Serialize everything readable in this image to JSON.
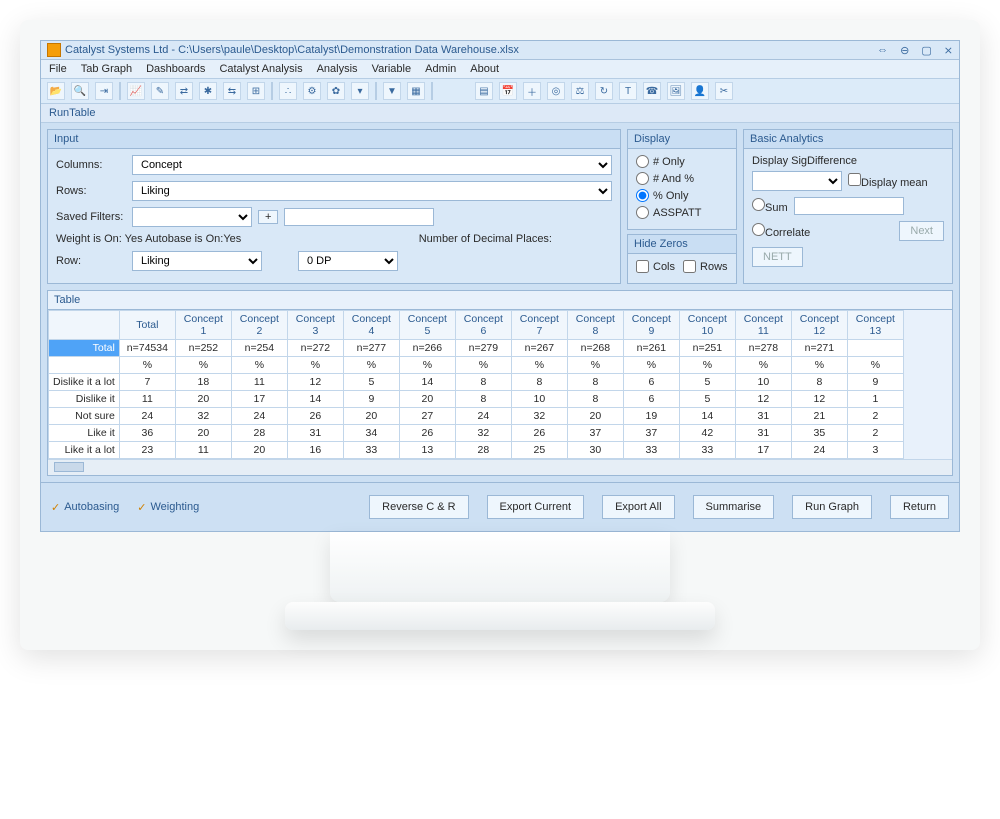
{
  "window": {
    "title": "Catalyst Systems Ltd - C:\\Users\\paule\\Desktop\\Catalyst\\Demonstration Data Warehouse.xlsx",
    "btn_link": "⇔",
    "btn_min": "⊖",
    "btn_max": "▢",
    "btn_close": "⨯"
  },
  "menu": [
    "File",
    "Tab Graph",
    "Dashboards",
    "Catalyst Analysis",
    "Analysis",
    "Variable",
    "Admin",
    "About"
  ],
  "tab": "RunTable",
  "input": {
    "title": "Input",
    "columns_lbl": "Columns:",
    "columns_val": "Concept",
    "rows_lbl": "Rows:",
    "rows_val": "Liking",
    "saved_lbl": "Saved Filters:",
    "plus": "+",
    "weight_txt": "Weight is On: Yes   Autobase is On:Yes",
    "dp_lbl": "Number of Decimal Places:",
    "row_lbl": "Row:",
    "row_val": "Liking",
    "dp_val": "0 DP"
  },
  "display": {
    "title": "Display",
    "opt1": "# Only",
    "opt2": "# And %",
    "opt3": "% Only",
    "opt4": "ASSPATT",
    "hide_title": "Hide Zeros",
    "hide_cols": "Cols",
    "hide_rows": "Rows"
  },
  "analytics": {
    "title": "Basic Analytics",
    "sig_lbl": "Display SigDifference",
    "mean_lbl": "Display mean",
    "sum_lbl": "Sum",
    "corr_lbl": "Correlate",
    "next": "Next",
    "nett": "NETT"
  },
  "table": {
    "title": "Table",
    "total_lbl": "Total",
    "cols": [
      "Concept 1",
      "Concept 2",
      "Concept 3",
      "Concept 4",
      "Concept 5",
      "Concept 6",
      "Concept 7",
      "Concept 8",
      "Concept 9",
      "Concept 10",
      "Concept 11",
      "Concept 12",
      "Concept 13"
    ],
    "nrow": [
      "n=74534",
      "n=252",
      "n=254",
      "n=272",
      "n=277",
      "n=266",
      "n=279",
      "n=267",
      "n=268",
      "n=261",
      "n=251",
      "n=278",
      "n=271",
      ""
    ],
    "pctrow": [
      "%",
      "%",
      "%",
      "%",
      "%",
      "%",
      "%",
      "%",
      "%",
      "%",
      "%",
      "%",
      "%",
      "%"
    ],
    "rows": [
      {
        "label": "Dislike it a lot",
        "vals": [
          "7",
          "18",
          "11",
          "12",
          "5",
          "14",
          "8",
          "8",
          "8",
          "6",
          "5",
          "10",
          "8",
          "9"
        ]
      },
      {
        "label": "Dislike it",
        "vals": [
          "11",
          "20",
          "17",
          "14",
          "9",
          "20",
          "8",
          "10",
          "8",
          "6",
          "5",
          "12",
          "12",
          "1"
        ]
      },
      {
        "label": "Not sure",
        "vals": [
          "24",
          "32",
          "24",
          "26",
          "20",
          "27",
          "24",
          "32",
          "20",
          "19",
          "14",
          "31",
          "21",
          "2"
        ]
      },
      {
        "label": "Like it",
        "vals": [
          "36",
          "20",
          "28",
          "31",
          "34",
          "26",
          "32",
          "26",
          "37",
          "37",
          "42",
          "31",
          "35",
          "2"
        ]
      },
      {
        "label": "Like it a lot",
        "vals": [
          "23",
          "11",
          "20",
          "16",
          "33",
          "13",
          "28",
          "25",
          "30",
          "33",
          "33",
          "17",
          "24",
          "3"
        ]
      }
    ]
  },
  "footer": {
    "autobasing": "Autobasing",
    "weighting": "Weighting",
    "reverse": "Reverse C & R",
    "export_cur": "Export Current",
    "export_all": "Export All",
    "summarise": "Summarise",
    "run_graph": "Run Graph",
    "return": "Return"
  },
  "chart_data": {
    "type": "table",
    "title": "Liking by Concept (% Only)",
    "columns": [
      "Total",
      "Concept 1",
      "Concept 2",
      "Concept 3",
      "Concept 4",
      "Concept 5",
      "Concept 6",
      "Concept 7",
      "Concept 8",
      "Concept 9",
      "Concept 10",
      "Concept 11",
      "Concept 12"
    ],
    "n": [
      74534,
      252,
      254,
      272,
      277,
      266,
      279,
      267,
      268,
      261,
      251,
      278,
      271
    ],
    "rows": [
      {
        "label": "Dislike it a lot",
        "values": [
          7,
          18,
          11,
          12,
          5,
          14,
          8,
          8,
          8,
          6,
          5,
          10,
          8
        ]
      },
      {
        "label": "Dislike it",
        "values": [
          11,
          20,
          17,
          14,
          9,
          20,
          8,
          10,
          8,
          6,
          5,
          12,
          12
        ]
      },
      {
        "label": "Not sure",
        "values": [
          24,
          32,
          24,
          26,
          20,
          27,
          24,
          32,
          20,
          19,
          14,
          31,
          21
        ]
      },
      {
        "label": "Like it",
        "values": [
          36,
          20,
          28,
          31,
          34,
          26,
          32,
          26,
          37,
          37,
          42,
          31,
          35
        ]
      },
      {
        "label": "Like it a lot",
        "values": [
          23,
          11,
          20,
          16,
          33,
          13,
          28,
          25,
          30,
          33,
          33,
          17,
          24
        ]
      }
    ],
    "unit": "%"
  }
}
